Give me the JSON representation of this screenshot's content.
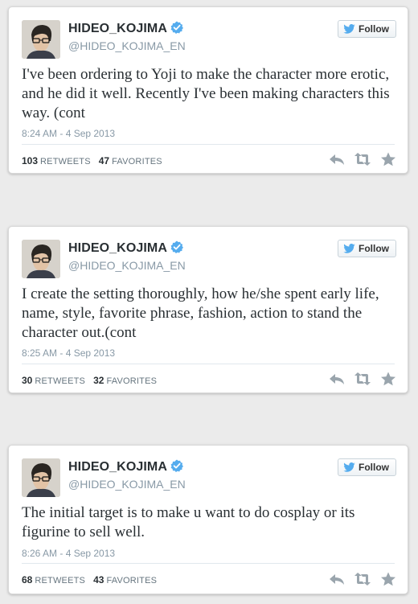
{
  "tweets": [
    {
      "name": "HIDEO_KOJIMA",
      "handle": "@HIDEO_KOJIMA_EN",
      "follow_label": "Follow",
      "text": "I've been ordering to Yoji to make the character more erotic, and he did it well. Recently I've been making characters this way. (cont",
      "timestamp": "8:24 AM - 4 Sep 2013",
      "retweets": "103",
      "retweets_label": "RETWEETS",
      "favorites": "47",
      "favorites_label": "FAVORITES"
    },
    {
      "name": "HIDEO_KOJIMA",
      "handle": "@HIDEO_KOJIMA_EN",
      "follow_label": "Follow",
      "text": "I create the setting thoroughly, how he/she spent early life, name, style, favorite phrase, fashion, action to stand the character out.(cont",
      "timestamp": "8:25 AM - 4 Sep 2013",
      "retweets": "30",
      "retweets_label": "RETWEETS",
      "favorites": "32",
      "favorites_label": "FAVORITES"
    },
    {
      "name": "HIDEO_KOJIMA",
      "handle": "@HIDEO_KOJIMA_EN",
      "follow_label": "Follow",
      "text": "The initial target is to make u want to do cosplay or its figurine to sell well.",
      "timestamp": "8:26 AM - 4 Sep 2013",
      "retweets": "68",
      "retweets_label": "RETWEETS",
      "favorites": "43",
      "favorites_label": "FAVORITES"
    }
  ],
  "icons": {
    "verified": "verified-badge-icon",
    "twitter": "twitter-bird-icon",
    "reply": "reply-icon",
    "retweet": "retweet-icon",
    "favorite": "star-icon"
  },
  "colors": {
    "verified": "#55acee",
    "twitter_blue": "#55acee",
    "action_grey": "#9aa5ad",
    "background": "#ebebeb"
  }
}
